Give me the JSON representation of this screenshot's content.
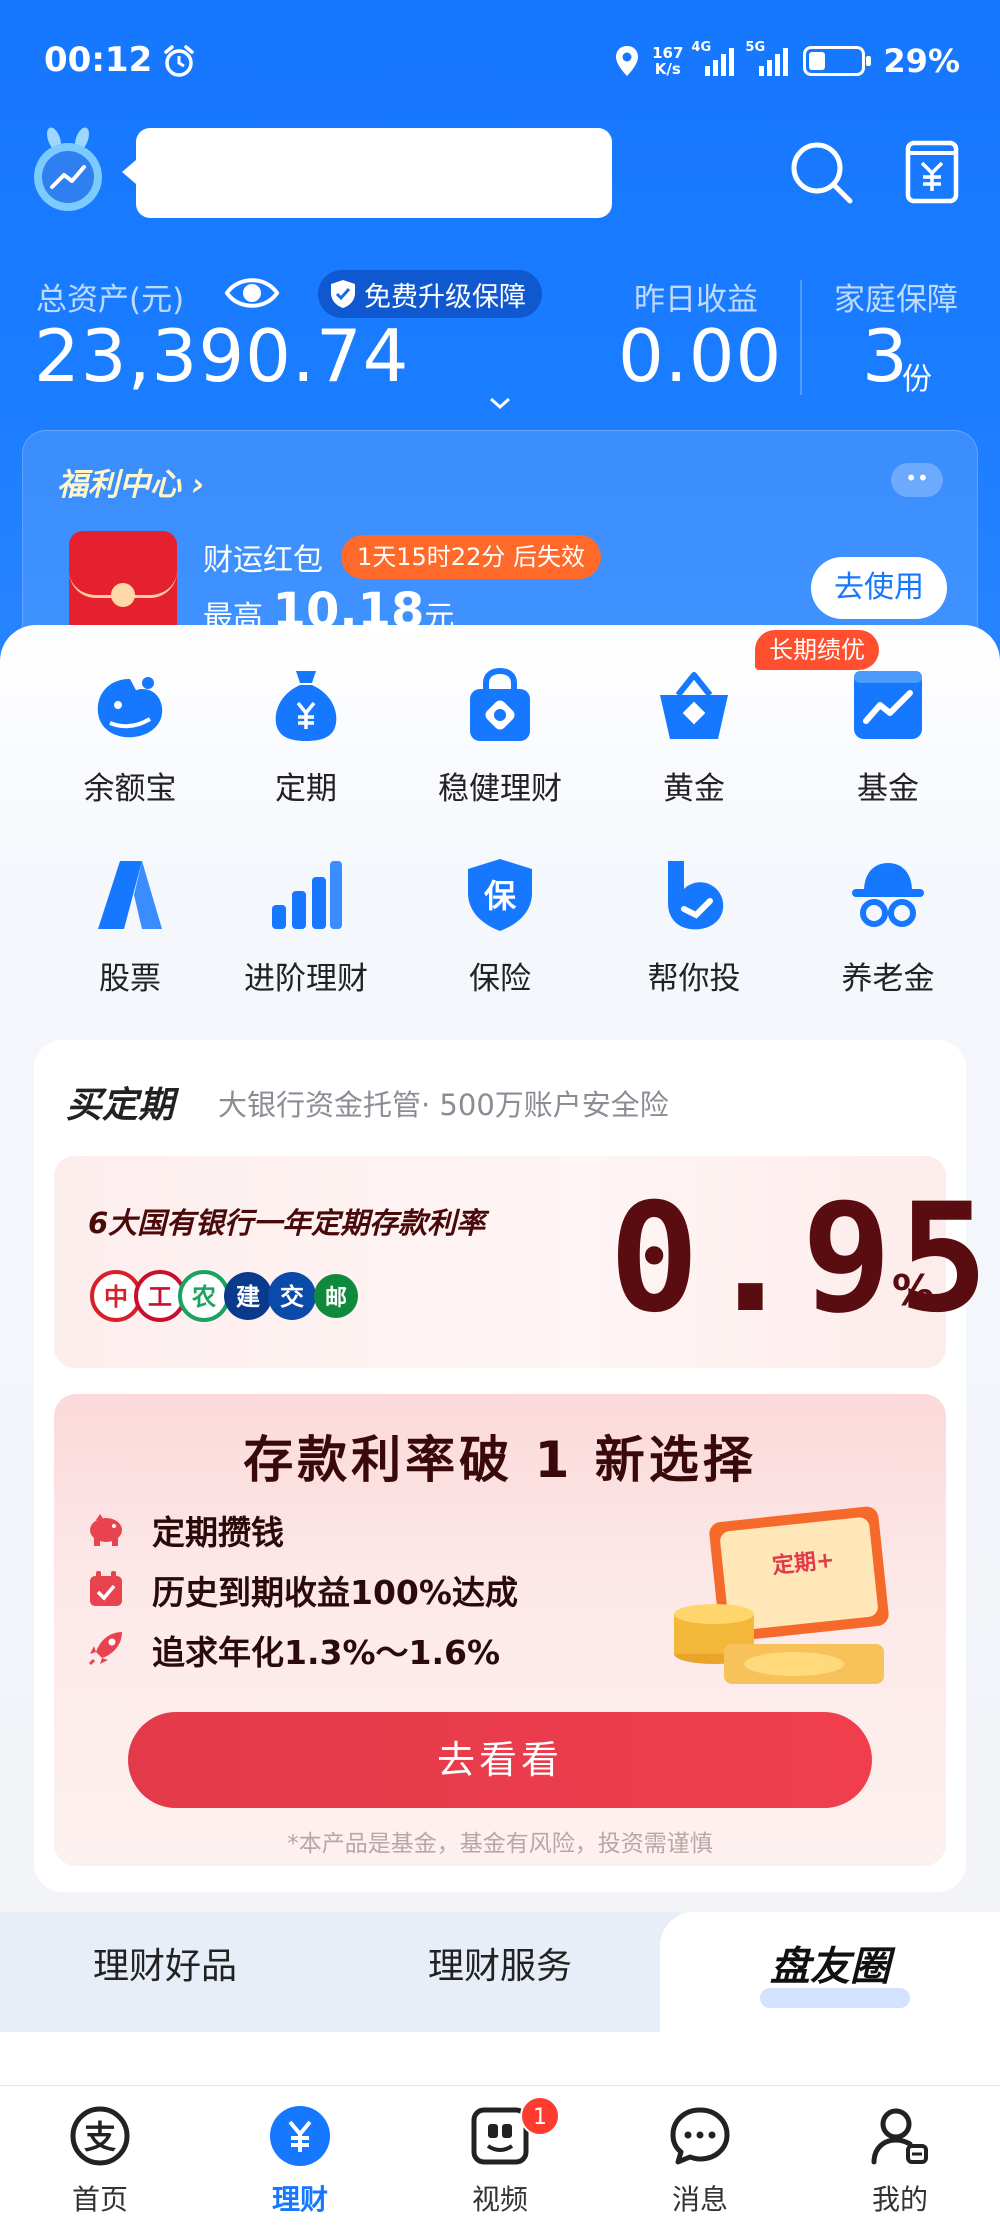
{
  "status_bar": {
    "time": "00:12",
    "net_speed_value": "167",
    "net_speed_unit": "K/s",
    "sig1_tag": "4G",
    "sig2_tag": "5G",
    "battery": "29%"
  },
  "assets": {
    "total_label": "总资产(元)",
    "total_value": "23,390.74",
    "upgrade_label": "免费升级保障",
    "yesterday_label": "昨日收益",
    "yesterday_value": "0.00",
    "family_label": "家庭保障",
    "family_value": "3",
    "family_unit": "份"
  },
  "welfare": {
    "title": "福利中心 ›",
    "more": "••",
    "packet_name": "财运红包",
    "expire": "1天15时22分 后失效",
    "max_prefix": "最高",
    "amount": "10.18",
    "unit": "元",
    "use_button": "去使用"
  },
  "menu": {
    "badge": "长期绩优",
    "items": [
      {
        "label": "余额宝",
        "icon": "yuebao-icon"
      },
      {
        "label": "定期",
        "icon": "money-bag-icon"
      },
      {
        "label": "稳健理财",
        "icon": "lock-bag-icon"
      },
      {
        "label": "黄金",
        "icon": "gold-basket-icon"
      },
      {
        "label": "基金",
        "icon": "fund-chart-icon"
      },
      {
        "label": "股票",
        "icon": "stock-a-icon"
      },
      {
        "label": "进阶理财",
        "icon": "bars-icon"
      },
      {
        "label": "保险",
        "icon": "insurance-shield-icon"
      },
      {
        "label": "帮你投",
        "icon": "bangnitou-icon"
      },
      {
        "label": "养老金",
        "icon": "pension-hat-icon"
      }
    ]
  },
  "fixed": {
    "title": "买定期",
    "subtitle": "大银行资金托管· 500万账户安全险",
    "rate_text": "6大国有银行一年定期存款利率",
    "rate_value": "0.95",
    "rate_unit": "%",
    "promo_title": "存款利率破 1 新选择",
    "features": [
      "定期攒钱",
      "历史到期收益100%达成",
      "追求年化1.3%～1.6%"
    ],
    "card_text": "定期+",
    "go_button": "去看看",
    "disclaimer": "*本产品是基金，基金有风险，投资需谨慎"
  },
  "tabs": {
    "items": [
      "理财好品",
      "理财服务",
      "盘友圈"
    ],
    "active": "盘友圈"
  },
  "bottom_nav": {
    "items": [
      {
        "label": "首页",
        "icon": "alipay-icon"
      },
      {
        "label": "理财",
        "icon": "yen-icon"
      },
      {
        "label": "视频",
        "icon": "video-icon"
      },
      {
        "label": "消息",
        "icon": "chat-icon"
      },
      {
        "label": "我的",
        "icon": "profile-icon"
      }
    ],
    "video_badge": "1",
    "active": "理财"
  },
  "colors": {
    "brand_blue": "#1677ff",
    "promo_red": "#e33a4a",
    "rate_dark_red": "#5a0d10"
  }
}
